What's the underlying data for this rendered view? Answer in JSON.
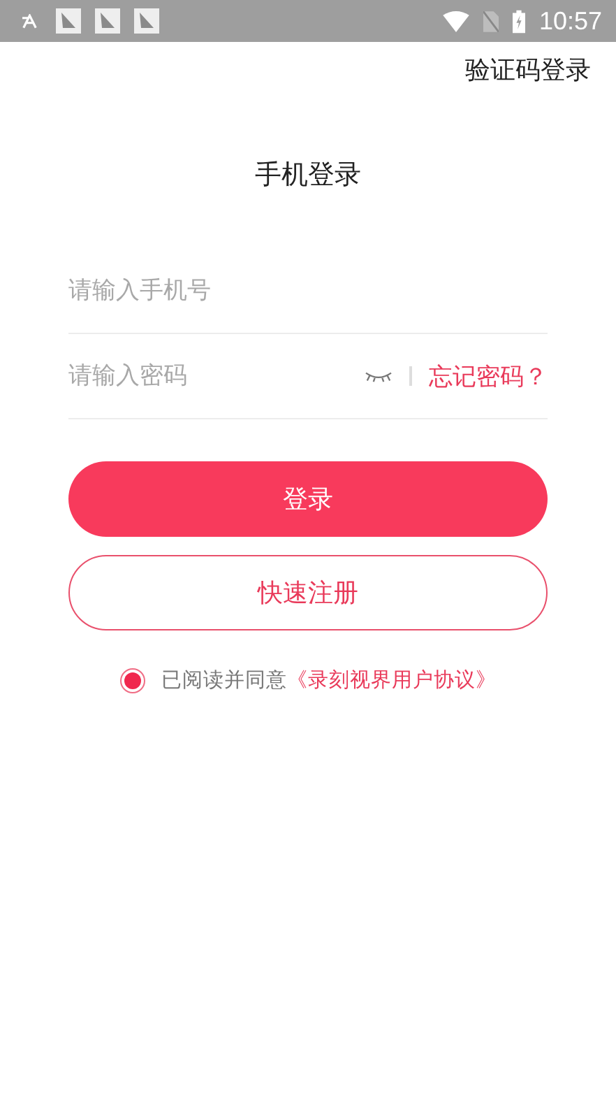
{
  "status_bar": {
    "time": "10:57"
  },
  "top_link": "验证码登录",
  "title": "手机登录",
  "phone_field": {
    "placeholder": "请输入手机号"
  },
  "password_field": {
    "placeholder": "请输入密码",
    "password_visible": false
  },
  "forgot_link": "忘记密码？",
  "login_button": "登录",
  "register_button": "快速注册",
  "agreement": {
    "agreed": true,
    "text": "已阅读并同意",
    "link": "《录刻视界用户协议》"
  }
}
